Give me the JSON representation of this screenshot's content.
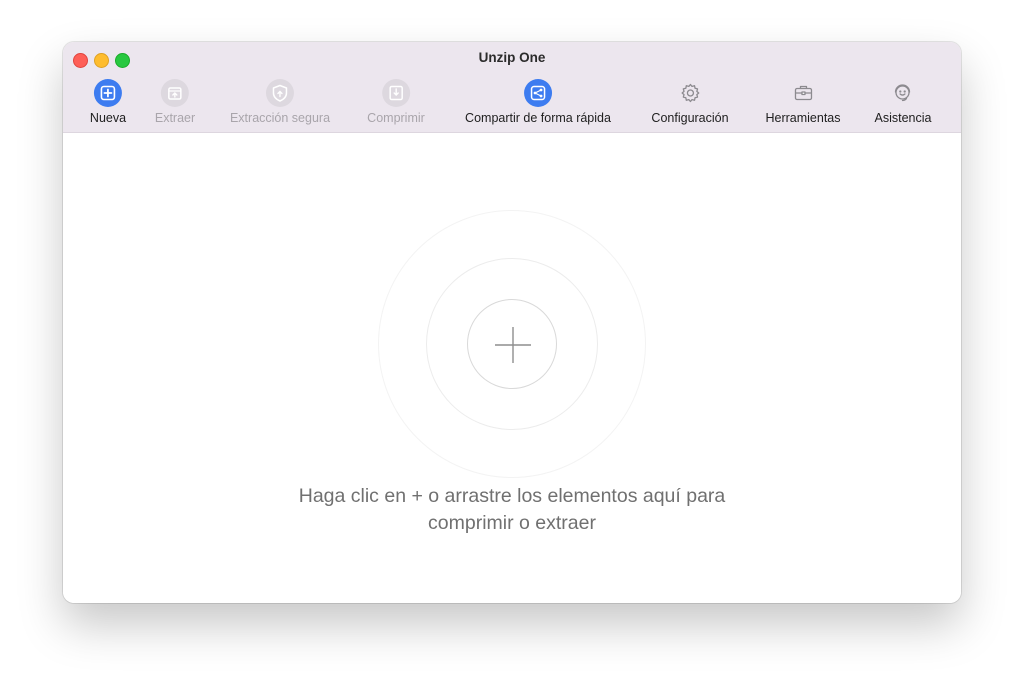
{
  "window": {
    "title": "Unzip One"
  },
  "toolbar": {
    "items": [
      {
        "label": "Nueva",
        "icon": "new-archive-icon",
        "enabled": true
      },
      {
        "label": "Extraer",
        "icon": "extract-icon",
        "enabled": false
      },
      {
        "label": "Extracción segura",
        "icon": "secure-extract-icon",
        "enabled": false
      },
      {
        "label": "Comprimir",
        "icon": "compress-icon",
        "enabled": false
      },
      {
        "label": "Compartir de forma rápida",
        "icon": "quick-share-icon",
        "enabled": true
      },
      {
        "label": "Configuración",
        "icon": "gear-icon",
        "enabled": true
      },
      {
        "label": "Herramientas",
        "icon": "toolbox-icon",
        "enabled": true
      },
      {
        "label": "Asistencia",
        "icon": "support-icon",
        "enabled": true
      }
    ]
  },
  "dropzone": {
    "hint_line1": "Haga clic en + o arrastre los elementos aquí para",
    "hint_line2": "comprimir o extraer"
  },
  "colors": {
    "accent": "#3d7cf0",
    "titlebar": "#ece6ee",
    "disabled_text": "#a9a5ab"
  }
}
